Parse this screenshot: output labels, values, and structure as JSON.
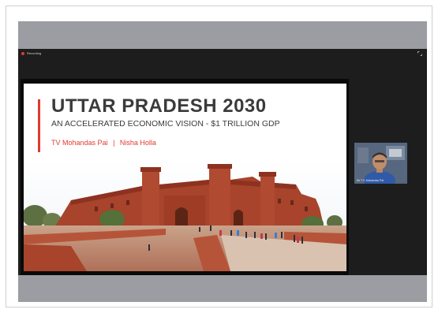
{
  "meeting": {
    "recording_label": "Recording",
    "participant_name": "Mr T.V. Mohandas Pai"
  },
  "slide": {
    "title": "UTTAR PRADESH 2030",
    "subtitle": "AN ACCELERATED ECONOMIC VISION - $1 TRILLION GDP",
    "author_1": "TV Mohandas Pai",
    "separator": "|",
    "author_2": "Nisha Holla"
  },
  "colors": {
    "accent": "#e03a2f",
    "band": "#9b9da2",
    "meeting_bg": "#1d1d1d",
    "fort": "#a8432c"
  },
  "icons": [
    "recording-dot-icon",
    "expand-icon"
  ]
}
